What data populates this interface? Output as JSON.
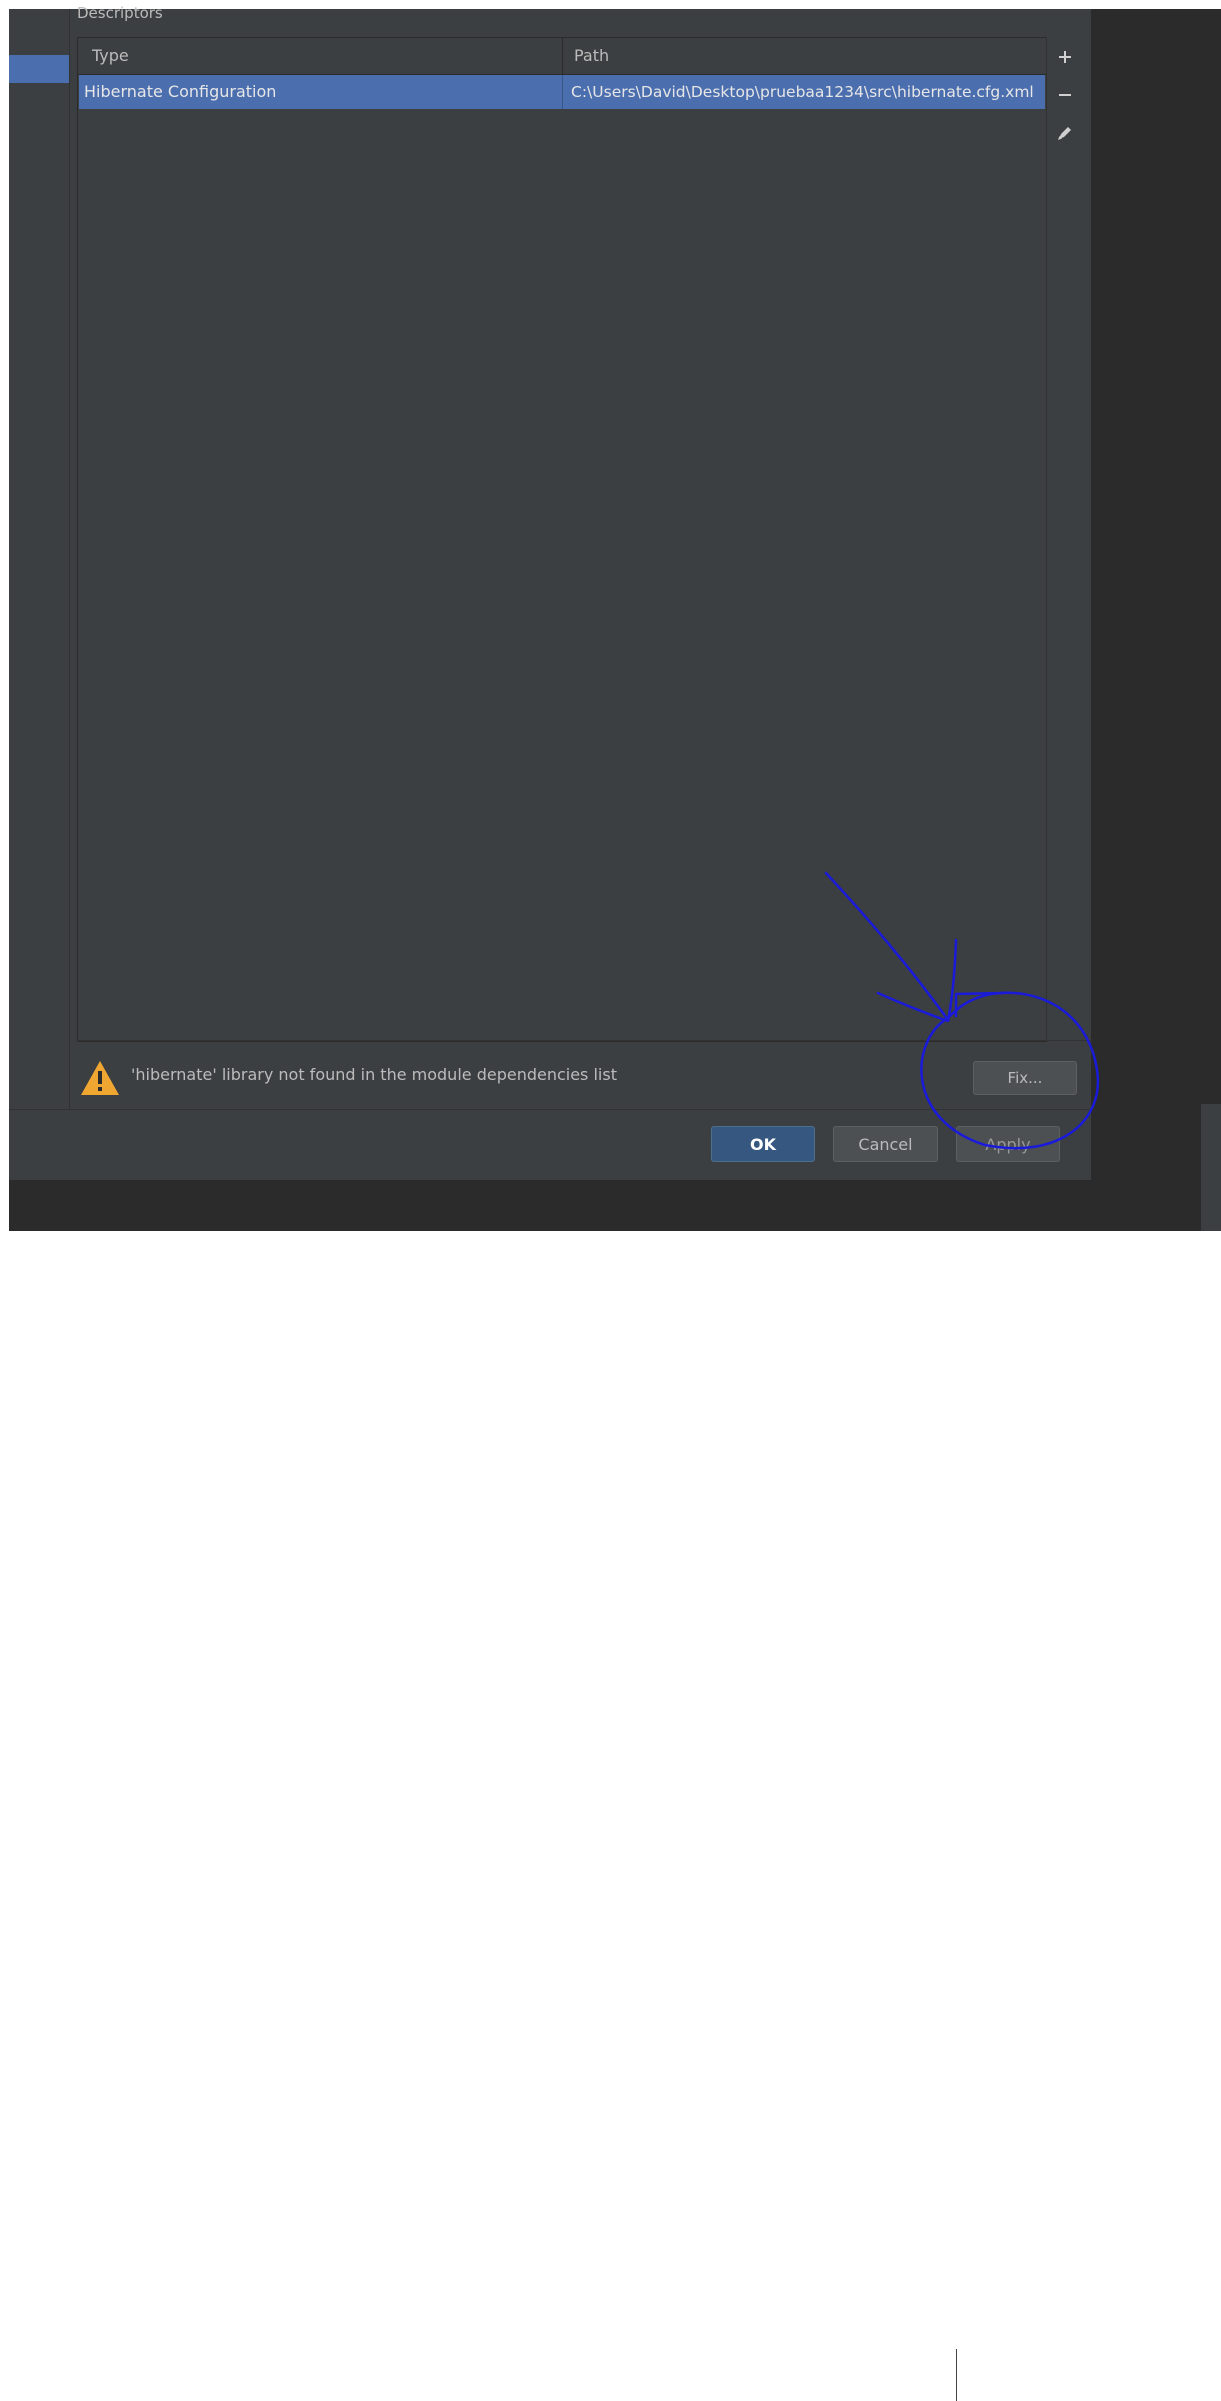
{
  "section": {
    "label": "Descriptors"
  },
  "table": {
    "columns": {
      "type": "Type",
      "path": "Path"
    },
    "rows": [
      {
        "type": "Hibernate Configuration",
        "path": "C:\\Users\\David\\Desktop\\pruebaa1234\\src\\hibernate.cfg.xml"
      }
    ]
  },
  "toolbar": {
    "add_icon": "plus-icon",
    "remove_icon": "minus-icon",
    "edit_icon": "pencil-icon"
  },
  "warning": {
    "icon": "warning-icon",
    "text": "'hibernate' library not found in the module dependencies list",
    "fix_label": "Fix..."
  },
  "buttons": {
    "ok": "OK",
    "cancel": "Cancel",
    "apply": "Apply"
  },
  "colors": {
    "selection": "#4b6eaf",
    "background": "#3c3f41",
    "annotation": "#1a1adb",
    "warning": "#f0a732"
  }
}
